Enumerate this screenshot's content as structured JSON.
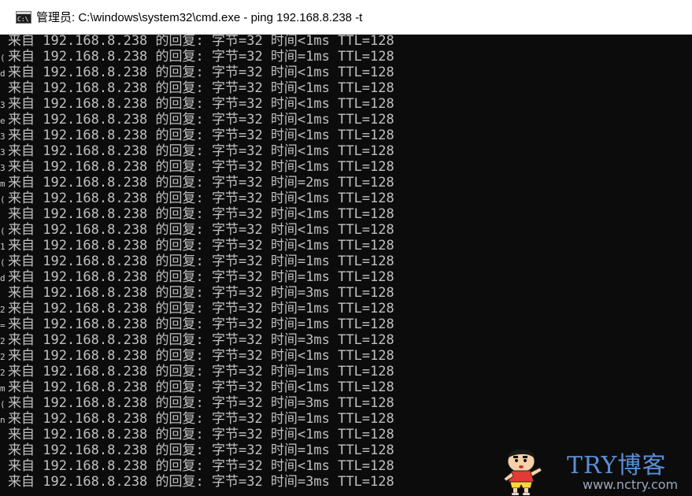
{
  "window": {
    "title": "管理员: C:\\windows\\system32\\cmd.exe - ping  192.168.8.238 -t",
    "icon": "cmd-icon"
  },
  "left_strip_ghost_chars": [
    "(",
    "d",
    "",
    "3",
    "e",
    "3",
    "3",
    "3",
    "m",
    "(",
    "",
    "(",
    "1",
    "(",
    "d",
    "",
    "2",
    "=",
    "2",
    "2",
    "2",
    "m",
    "(",
    "n"
  ],
  "console": {
    "lines": [
      "来自 192.168.8.238 的回复: 字节=32 时间<1ms TTL=128",
      "来自 192.168.8.238 的回复: 字节=32 时间=1ms TTL=128",
      "来自 192.168.8.238 的回复: 字节=32 时间<1ms TTL=128",
      "来自 192.168.8.238 的回复: 字节=32 时间<1ms TTL=128",
      "来自 192.168.8.238 的回复: 字节=32 时间<1ms TTL=128",
      "来自 192.168.8.238 的回复: 字节=32 时间<1ms TTL=128",
      "来自 192.168.8.238 的回复: 字节=32 时间<1ms TTL=128",
      "来自 192.168.8.238 的回复: 字节=32 时间<1ms TTL=128",
      "来自 192.168.8.238 的回复: 字节=32 时间<1ms TTL=128",
      "来自 192.168.8.238 的回复: 字节=32 时间=2ms TTL=128",
      "来自 192.168.8.238 的回复: 字节=32 时间<1ms TTL=128",
      "来自 192.168.8.238 的回复: 字节=32 时间<1ms TTL=128",
      "来自 192.168.8.238 的回复: 字节=32 时间<1ms TTL=128",
      "来自 192.168.8.238 的回复: 字节=32 时间<1ms TTL=128",
      "来自 192.168.8.238 的回复: 字节=32 时间=1ms TTL=128",
      "来自 192.168.8.238 的回复: 字节=32 时间=1ms TTL=128",
      "来自 192.168.8.238 的回复: 字节=32 时间=3ms TTL=128",
      "来自 192.168.8.238 的回复: 字节=32 时间=1ms TTL=128",
      "来自 192.168.8.238 的回复: 字节=32 时间=1ms TTL=128",
      "来自 192.168.8.238 的回复: 字节=32 时间=3ms TTL=128",
      "来自 192.168.8.238 的回复: 字节=32 时间<1ms TTL=128",
      "来自 192.168.8.238 的回复: 字节=32 时间=1ms TTL=128",
      "来自 192.168.8.238 的回复: 字节=32 时间<1ms TTL=128",
      "来自 192.168.8.238 的回复: 字节=32 时间=3ms TTL=128",
      "来自 192.168.8.238 的回复: 字节=32 时间=1ms TTL=128",
      "来自 192.168.8.238 的回复: 字节=32 时间<1ms TTL=128",
      "来自 192.168.8.238 的回复: 字节=32 时间=1ms TTL=128",
      "来自 192.168.8.238 的回复: 字节=32 时间<1ms TTL=128",
      "来自 192.168.8.238 的回复: 字节=32 时间=3ms TTL=128"
    ]
  },
  "watermark": {
    "brand": "TRY博客",
    "url": "www.nctry.com",
    "mascot": "crayon-shinchan-mascot"
  },
  "colors": {
    "console_bg": "#0c0c0c",
    "console_fg": "#c0c0c0",
    "titlebar_bg": "#ffffff",
    "watermark_brand": "#5a8fd8"
  }
}
